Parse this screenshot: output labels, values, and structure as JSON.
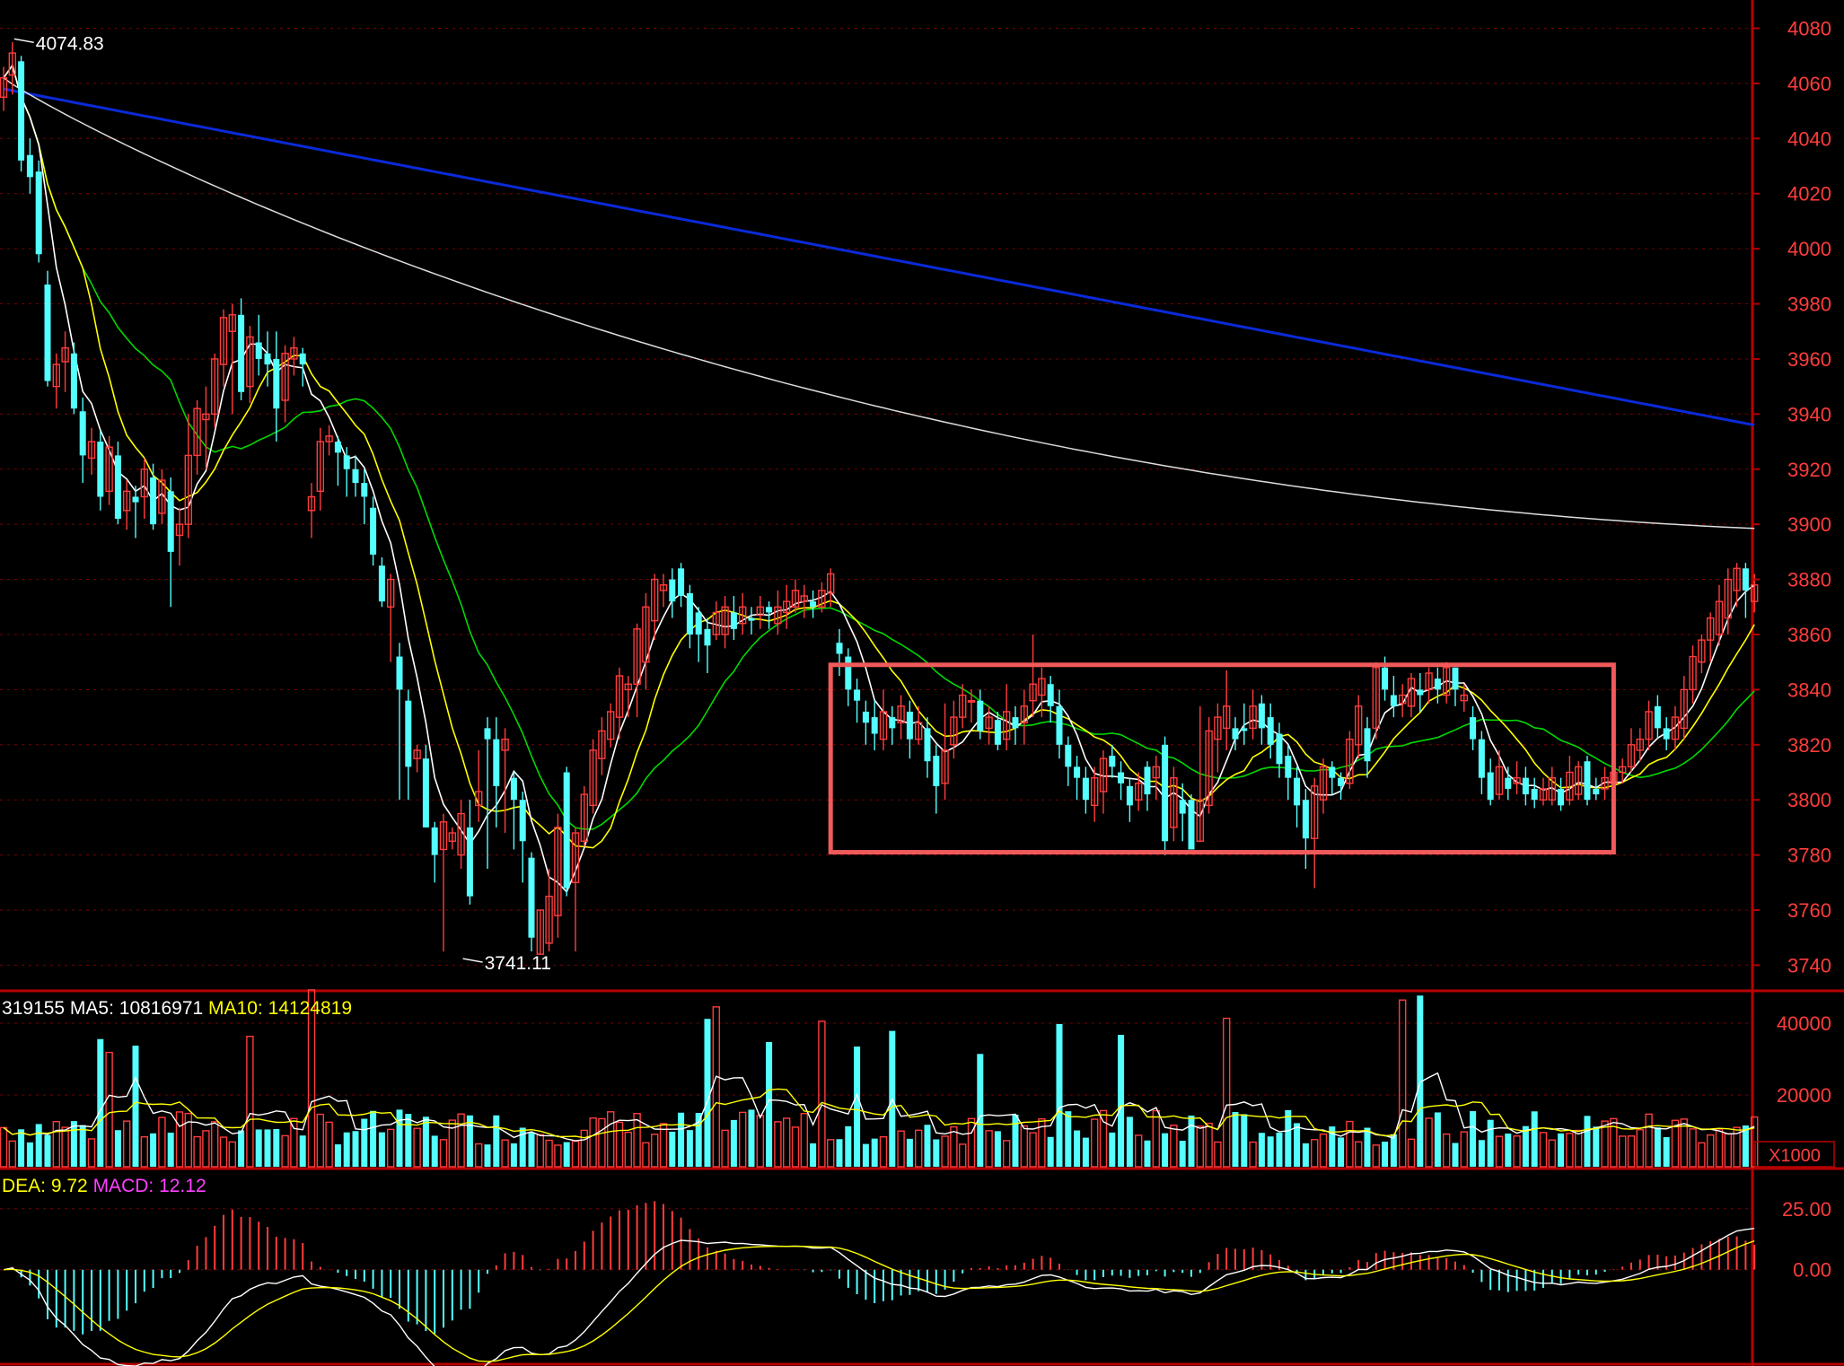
{
  "chart_data": [
    {
      "type": "candlestick",
      "panel": "price",
      "y_ticks": [
        4080,
        4060,
        4040,
        4020,
        4000,
        3980,
        3960,
        3940,
        3920,
        3900,
        3880,
        3860,
        3840,
        3820,
        3800,
        3780,
        3760,
        3740
      ],
      "ylim": [
        3732,
        4087
      ],
      "annotations": {
        "high_label": "4074.83",
        "low_label": "3741.11"
      },
      "highlight_box": {
        "price_low": 3781,
        "price_high": 3849,
        "bar_start": 94,
        "bar_end": 183,
        "color": "#f05a5a"
      },
      "bars": [
        [
          4055,
          4062,
          4050,
          4066
        ],
        [
          4063,
          4071,
          4056,
          4075
        ],
        [
          4068,
          4032,
          4028,
          4070
        ],
        [
          4034,
          4026,
          4020,
          4040
        ],
        [
          4028,
          3998,
          3995,
          4032
        ],
        [
          3987,
          3952,
          3950,
          3992
        ],
        [
          3950,
          3958,
          3942,
          3962
        ],
        [
          3959,
          3964,
          3948,
          3970
        ],
        [
          3962,
          3942,
          3940,
          3966
        ],
        [
          3941,
          3925,
          3915,
          3946
        ],
        [
          3924,
          3930,
          3918,
          3935
        ],
        [
          3930,
          3910,
          3905,
          3934
        ],
        [
          3912,
          3928,
          3907,
          3932
        ],
        [
          3925,
          3902,
          3900,
          3930
        ],
        [
          3905,
          3912,
          3898,
          3916
        ],
        [
          3910,
          3908,
          3895,
          3914
        ],
        [
          3910,
          3920,
          3902,
          3924
        ],
        [
          3917,
          3900,
          3898,
          3922
        ],
        [
          3904,
          3916,
          3900,
          3920
        ],
        [
          3912,
          3890,
          3870,
          3917
        ],
        [
          3896,
          3900,
          3885,
          3906
        ],
        [
          3900,
          3925,
          3895,
          3940
        ],
        [
          3925,
          3942,
          3918,
          3945
        ],
        [
          3938,
          3940,
          3920,
          3950
        ],
        [
          3940,
          3960,
          3935,
          3962
        ],
        [
          3958,
          3975,
          3950,
          3978
        ],
        [
          3970,
          3976,
          3940,
          3980
        ],
        [
          3976,
          3948,
          3945,
          3982
        ],
        [
          3950,
          3968,
          3944,
          3972
        ],
        [
          3966,
          3960,
          3954,
          3976
        ],
        [
          3962,
          3958,
          3950,
          3970
        ],
        [
          3960,
          3942,
          3930,
          3970
        ],
        [
          3945,
          3962,
          3937,
          3965
        ],
        [
          3960,
          3964,
          3954,
          3968
        ],
        [
          3962,
          3958,
          3950,
          3964
        ],
        [
          3905,
          3910,
          3895,
          3915
        ],
        [
          3912,
          3930,
          3905,
          3935
        ],
        [
          3930,
          3932,
          3925,
          3936
        ],
        [
          3930,
          3926,
          3914,
          3932
        ],
        [
          3925,
          3920,
          3910,
          3928
        ],
        [
          3920,
          3915,
          3910,
          3925
        ],
        [
          3915,
          3910,
          3900,
          3920
        ],
        [
          3906,
          3889,
          3885,
          3910
        ],
        [
          3885,
          3872,
          3870,
          3888
        ],
        [
          3870,
          3880,
          3850,
          3882
        ],
        [
          3852,
          3840,
          3800,
          3857
        ],
        [
          3836,
          3812,
          3800,
          3840
        ],
        [
          3815,
          3818,
          3810,
          3820
        ],
        [
          3815,
          3790,
          3790,
          3820
        ],
        [
          3790,
          3780,
          3770,
          3792
        ],
        [
          3782,
          3792,
          3745,
          3795
        ],
        [
          3785,
          3788,
          3782,
          3790
        ],
        [
          3780,
          3795,
          3775,
          3800
        ],
        [
          3790,
          3765,
          3762,
          3800
        ],
        [
          3798,
          3803,
          3792,
          3818
        ],
        [
          3826,
          3822,
          3775,
          3830
        ],
        [
          3822,
          3805,
          3790,
          3830
        ],
        [
          3818,
          3822,
          3788,
          3826
        ],
        [
          3808,
          3800,
          3782,
          3810
        ],
        [
          3800,
          3785,
          3770,
          3803
        ],
        [
          3779,
          3750,
          3745,
          3781
        ],
        [
          3744,
          3760,
          3744,
          3760
        ],
        [
          3748,
          3765,
          3745,
          3775
        ],
        [
          3758,
          3790,
          3750,
          3795
        ],
        [
          3810,
          3768,
          3765,
          3812
        ],
        [
          3770,
          3788,
          3745,
          3790
        ],
        [
          3785,
          3802,
          3783,
          3805
        ],
        [
          3798,
          3818,
          3795,
          3822
        ],
        [
          3815,
          3825,
          3809,
          3830
        ],
        [
          3822,
          3832,
          3819,
          3835
        ],
        [
          3830,
          3845,
          3822,
          3848
        ],
        [
          3840,
          3842,
          3830,
          3845
        ],
        [
          3842,
          3862,
          3830,
          3864
        ],
        [
          3850,
          3870,
          3840,
          3875
        ],
        [
          3865,
          3880,
          3858,
          3882
        ],
        [
          3876,
          3878,
          3870,
          3882
        ],
        [
          3880,
          3872,
          3866,
          3884
        ],
        [
          3884,
          3874,
          3870,
          3886
        ],
        [
          3875,
          3860,
          3855,
          3878
        ],
        [
          3868,
          3860,
          3850,
          3870
        ],
        [
          3862,
          3856,
          3846,
          3866
        ],
        [
          3860,
          3868,
          3858,
          3872
        ],
        [
          3860,
          3870,
          3855,
          3874
        ],
        [
          3868,
          3862,
          3858,
          3874
        ],
        [
          3864,
          3870,
          3860,
          3875
        ],
        [
          3866,
          3865,
          3860,
          3870
        ],
        [
          3867,
          3870,
          3862,
          3874
        ],
        [
          3870,
          3868,
          3862,
          3872
        ],
        [
          3864,
          3870,
          3860,
          3876
        ],
        [
          3868,
          3872,
          3862,
          3878
        ],
        [
          3870,
          3876,
          3868,
          3880
        ],
        [
          3872,
          3874,
          3866,
          3878
        ],
        [
          3872,
          3870,
          3866,
          3876
        ],
        [
          3870,
          3876,
          3868,
          3879
        ],
        [
          3875,
          3882,
          3870,
          3884
        ],
        [
          3857,
          3853,
          3845,
          3862
        ],
        [
          3852,
          3840,
          3834,
          3855
        ],
        [
          3840,
          3836,
          3828,
          3844
        ],
        [
          3832,
          3828,
          3820,
          3836
        ],
        [
          3830,
          3824,
          3818,
          3836
        ],
        [
          3822,
          3832,
          3818,
          3840
        ],
        [
          3830,
          3826,
          3820,
          3834
        ],
        [
          3828,
          3834,
          3822,
          3838
        ],
        [
          3832,
          3822,
          3815,
          3836
        ],
        [
          3822,
          3828,
          3820,
          3834
        ],
        [
          3826,
          3814,
          3808,
          3830
        ],
        [
          3816,
          3805,
          3795,
          3820
        ],
        [
          3806,
          3818,
          3800,
          3835
        ],
        [
          3820,
          3830,
          3815,
          3836
        ],
        [
          3830,
          3838,
          3826,
          3842
        ],
        [
          3836,
          3836,
          3828,
          3840
        ],
        [
          3836,
          3825,
          3822,
          3840
        ],
        [
          3826,
          3830,
          3820,
          3834
        ],
        [
          3829,
          3820,
          3818,
          3832
        ],
        [
          3822,
          3832,
          3818,
          3842
        ],
        [
          3830,
          3826,
          3820,
          3834
        ],
        [
          3828,
          3834,
          3820,
          3840
        ],
        [
          3836,
          3842,
          3830,
          3860
        ],
        [
          3838,
          3844,
          3830,
          3848
        ],
        [
          3842,
          3834,
          3828,
          3845
        ],
        [
          3834,
          3820,
          3815,
          3840
        ],
        [
          3820,
          3812,
          3805,
          3823
        ],
        [
          3812,
          3808,
          3800,
          3816
        ],
        [
          3808,
          3800,
          3795,
          3812
        ],
        [
          3798,
          3808,
          3792,
          3812
        ],
        [
          3803,
          3815,
          3795,
          3818
        ],
        [
          3816,
          3812,
          3808,
          3820
        ],
        [
          3810,
          3806,
          3800,
          3814
        ],
        [
          3805,
          3798,
          3792,
          3808
        ],
        [
          3800,
          3806,
          3796,
          3810
        ],
        [
          3812,
          3802,
          3796,
          3814
        ],
        [
          3808,
          3812,
          3800,
          3816
        ],
        [
          3820,
          3785,
          3780,
          3823
        ],
        [
          3790,
          3808,
          3785,
          3812
        ],
        [
          3800,
          3795,
          3785,
          3806
        ],
        [
          3800,
          3782,
          3785,
          3802
        ],
        [
          3785,
          3800,
          3785,
          3834
        ],
        [
          3798,
          3825,
          3795,
          3830
        ],
        [
          3822,
          3830,
          3810,
          3835
        ],
        [
          3826,
          3834,
          3818,
          3847
        ],
        [
          3826,
          3822,
          3818,
          3830
        ],
        [
          3826,
          3825,
          3820,
          3835
        ],
        [
          3826,
          3834,
          3822,
          3840
        ],
        [
          3835,
          3826,
          3820,
          3838
        ],
        [
          3830,
          3820,
          3815,
          3835
        ],
        [
          3824,
          3813,
          3808,
          3828
        ],
        [
          3816,
          3808,
          3800,
          3820
        ],
        [
          3808,
          3798,
          3790,
          3812
        ],
        [
          3800,
          3786,
          3775,
          3804
        ],
        [
          3786,
          3805,
          3768,
          3808
        ],
        [
          3800,
          3812,
          3795,
          3815
        ],
        [
          3812,
          3808,
          3802,
          3814
        ],
        [
          3808,
          3805,
          3800,
          3810
        ],
        [
          3806,
          3822,
          3804,
          3825
        ],
        [
          3820,
          3834,
          3815,
          3838
        ],
        [
          3826,
          3814,
          3808,
          3830
        ],
        [
          3826,
          3848,
          3822,
          3850
        ],
        [
          3848,
          3840,
          3836,
          3852
        ],
        [
          3838,
          3834,
          3830,
          3845
        ],
        [
          3835,
          3838,
          3830,
          3842
        ],
        [
          3834,
          3844,
          3830,
          3846
        ],
        [
          3840,
          3838,
          3832,
          3846
        ],
        [
          3840,
          3846,
          3835,
          3848
        ],
        [
          3844,
          3840,
          3835,
          3848
        ],
        [
          3838,
          3848,
          3835,
          3850
        ],
        [
          3848,
          3840,
          3834,
          3848
        ],
        [
          3836,
          3838,
          3832,
          3842
        ],
        [
          3830,
          3822,
          3818,
          3834
        ],
        [
          3822,
          3808,
          3802,
          3825
        ],
        [
          3810,
          3800,
          3798,
          3815
        ],
        [
          3802,
          3812,
          3800,
          3818
        ],
        [
          3808,
          3804,
          3800,
          3812
        ],
        [
          3806,
          3808,
          3802,
          3814
        ],
        [
          3808,
          3802,
          3798,
          3812
        ],
        [
          3804,
          3800,
          3797,
          3808
        ],
        [
          3800,
          3804,
          3798,
          3808
        ],
        [
          3800,
          3808,
          3798,
          3812
        ],
        [
          3804,
          3798,
          3796,
          3808
        ],
        [
          3800,
          3810,
          3798,
          3816
        ],
        [
          3802,
          3812,
          3800,
          3814
        ],
        [
          3814,
          3800,
          3798,
          3816
        ],
        [
          3804,
          3802,
          3800,
          3808
        ],
        [
          3804,
          3808,
          3800,
          3812
        ],
        [
          3806,
          3810,
          3804,
          3812
        ],
        [
          3810,
          3812,
          3806,
          3815
        ],
        [
          3812,
          3820,
          3810,
          3826
        ],
        [
          3818,
          3822,
          3814,
          3826
        ],
        [
          3822,
          3832,
          3818,
          3836
        ],
        [
          3834,
          3826,
          3822,
          3838
        ],
        [
          3826,
          3822,
          3818,
          3830
        ],
        [
          3822,
          3830,
          3818,
          3834
        ],
        [
          3826,
          3840,
          3822,
          3845
        ],
        [
          3840,
          3852,
          3835,
          3856
        ],
        [
          3850,
          3858,
          3846,
          3860
        ],
        [
          3858,
          3866,
          3850,
          3868
        ],
        [
          3860,
          3872,
          3856,
          3878
        ],
        [
          3866,
          3880,
          3860,
          3884
        ],
        [
          3876,
          3884,
          3870,
          3886
        ],
        [
          3884,
          3876,
          3866,
          3886
        ],
        [
          3872,
          3878,
          3868,
          3882
        ]
      ]
    },
    {
      "type": "bar",
      "panel": "volume",
      "header": [
        {
          "text": "319155",
          "color": "#ffffff"
        },
        {
          "text": "  MA5: 10816971",
          "color": "#ffffff"
        },
        {
          "text": "  MA10: 14124819",
          "color": "#ffff00"
        }
      ],
      "y_ticks": [
        40000,
        20000
      ],
      "unit_label": "X1000",
      "ylim": [
        0,
        48000
      ]
    },
    {
      "type": "line",
      "panel": "macd",
      "header": [
        {
          "text": "DEA: 9.72",
          "color": "#ffff00"
        },
        {
          "text": "  MACD: 12.12",
          "color": "#ff40ff"
        }
      ],
      "y_ticks": [
        25.0,
        0.0
      ],
      "ylim": [
        -38,
        40
      ]
    }
  ],
  "colors": {
    "up": "#ff3c3c",
    "down": "#54ffff",
    "ma5": "#ffffff",
    "ma10": "#ffff00",
    "ma20": "#00d800",
    "ma60": "#dcdcdc",
    "ma250": "#0a2ad8",
    "frame": "#b80000",
    "grid": "#780000",
    "axis_text": "#ff3c3c"
  }
}
